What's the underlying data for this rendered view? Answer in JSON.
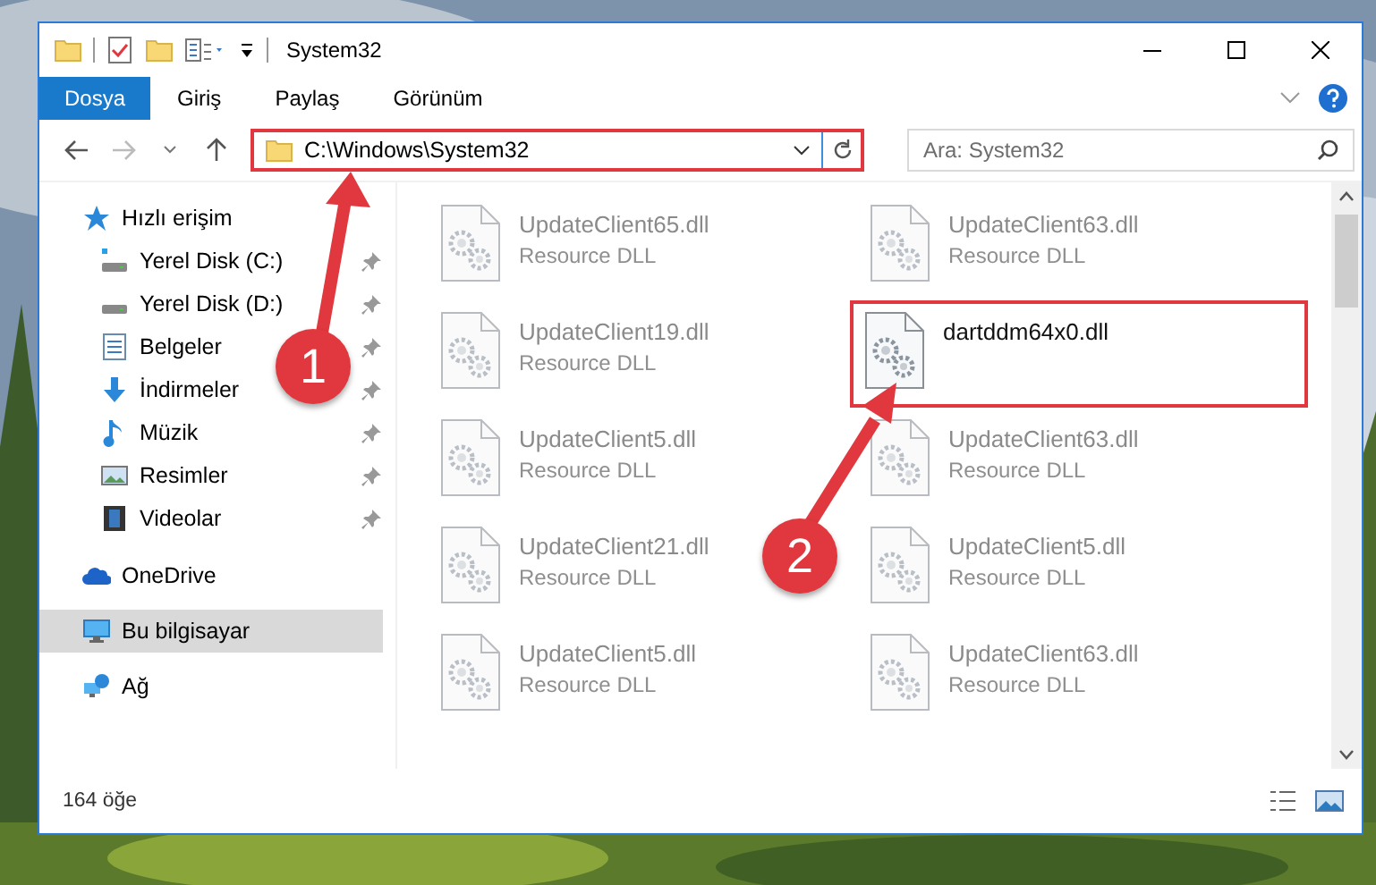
{
  "window": {
    "title": "System32"
  },
  "ribbon_tabs": [
    {
      "label": "Dosya",
      "selected": true
    },
    {
      "label": "Giriş",
      "selected": false
    },
    {
      "label": "Paylaş",
      "selected": false
    },
    {
      "label": "Görünüm",
      "selected": false
    }
  ],
  "address_bar": {
    "path": "C:\\Windows\\System32",
    "highlighted": true
  },
  "search": {
    "placeholder": "Ara: System32"
  },
  "sidebar": {
    "items": [
      {
        "label": "Hızlı erişim",
        "kind": "star",
        "selected": false,
        "children": [
          {
            "label": "Yerel Disk (C:)",
            "kind": "system-drive",
            "pinned": true,
            "selected": false
          },
          {
            "label": "Yerel Disk (D:)",
            "kind": "drive",
            "pinned": true,
            "selected": false
          },
          {
            "label": "Belgeler",
            "kind": "documents",
            "pinned": true,
            "selected": false
          },
          {
            "label": "İndirmeler",
            "kind": "downloads",
            "pinned": true,
            "selected": false
          },
          {
            "label": "Müzik",
            "kind": "music",
            "pinned": true,
            "selected": false
          },
          {
            "label": "Resimler",
            "kind": "pictures",
            "pinned": true,
            "selected": false
          },
          {
            "label": "Videolar",
            "kind": "videos",
            "pinned": true,
            "selected": false
          }
        ]
      },
      {
        "label": "OneDrive",
        "kind": "cloud",
        "selected": false
      },
      {
        "label": "Bu bilgisayar",
        "kind": "computer",
        "selected": true
      },
      {
        "label": "Ağ",
        "kind": "network",
        "selected": false
      }
    ]
  },
  "files": [
    {
      "name": "UpdateClient65.dll",
      "type": "Resource DLL",
      "blurred": true,
      "highlighted": false
    },
    {
      "name": "UpdateClient63.dll",
      "type": "Resource DLL",
      "blurred": true,
      "highlighted": false
    },
    {
      "name": "UpdateClient19.dll",
      "type": "Resource DLL",
      "blurred": true,
      "highlighted": false
    },
    {
      "name": "dartddm64x0.dll",
      "blurred": false,
      "highlighted": true
    },
    {
      "name": "UpdateClient5.dll",
      "type": "Resource DLL",
      "blurred": true,
      "highlighted": false
    },
    {
      "name": "UpdateClient63.dll",
      "type": "Resource DLL",
      "blurred": true,
      "highlighted": false
    },
    {
      "name": "UpdateClient21.dll",
      "type": "Resource DLL",
      "blurred": true,
      "highlighted": false
    },
    {
      "name": "UpdateClient5.dll",
      "type": "Resource DLL",
      "blurred": true,
      "highlighted": false
    },
    {
      "name": "UpdateClient5.dll",
      "type": "Resource DLL",
      "blurred": true,
      "highlighted": false
    },
    {
      "name": "UpdateClient63.dll",
      "type": "Resource DLL",
      "blurred": true,
      "highlighted": false
    }
  ],
  "annotations": [
    {
      "label": "1"
    },
    {
      "label": "2"
    }
  ],
  "status_bar": {
    "item_count": "164 öğe"
  }
}
